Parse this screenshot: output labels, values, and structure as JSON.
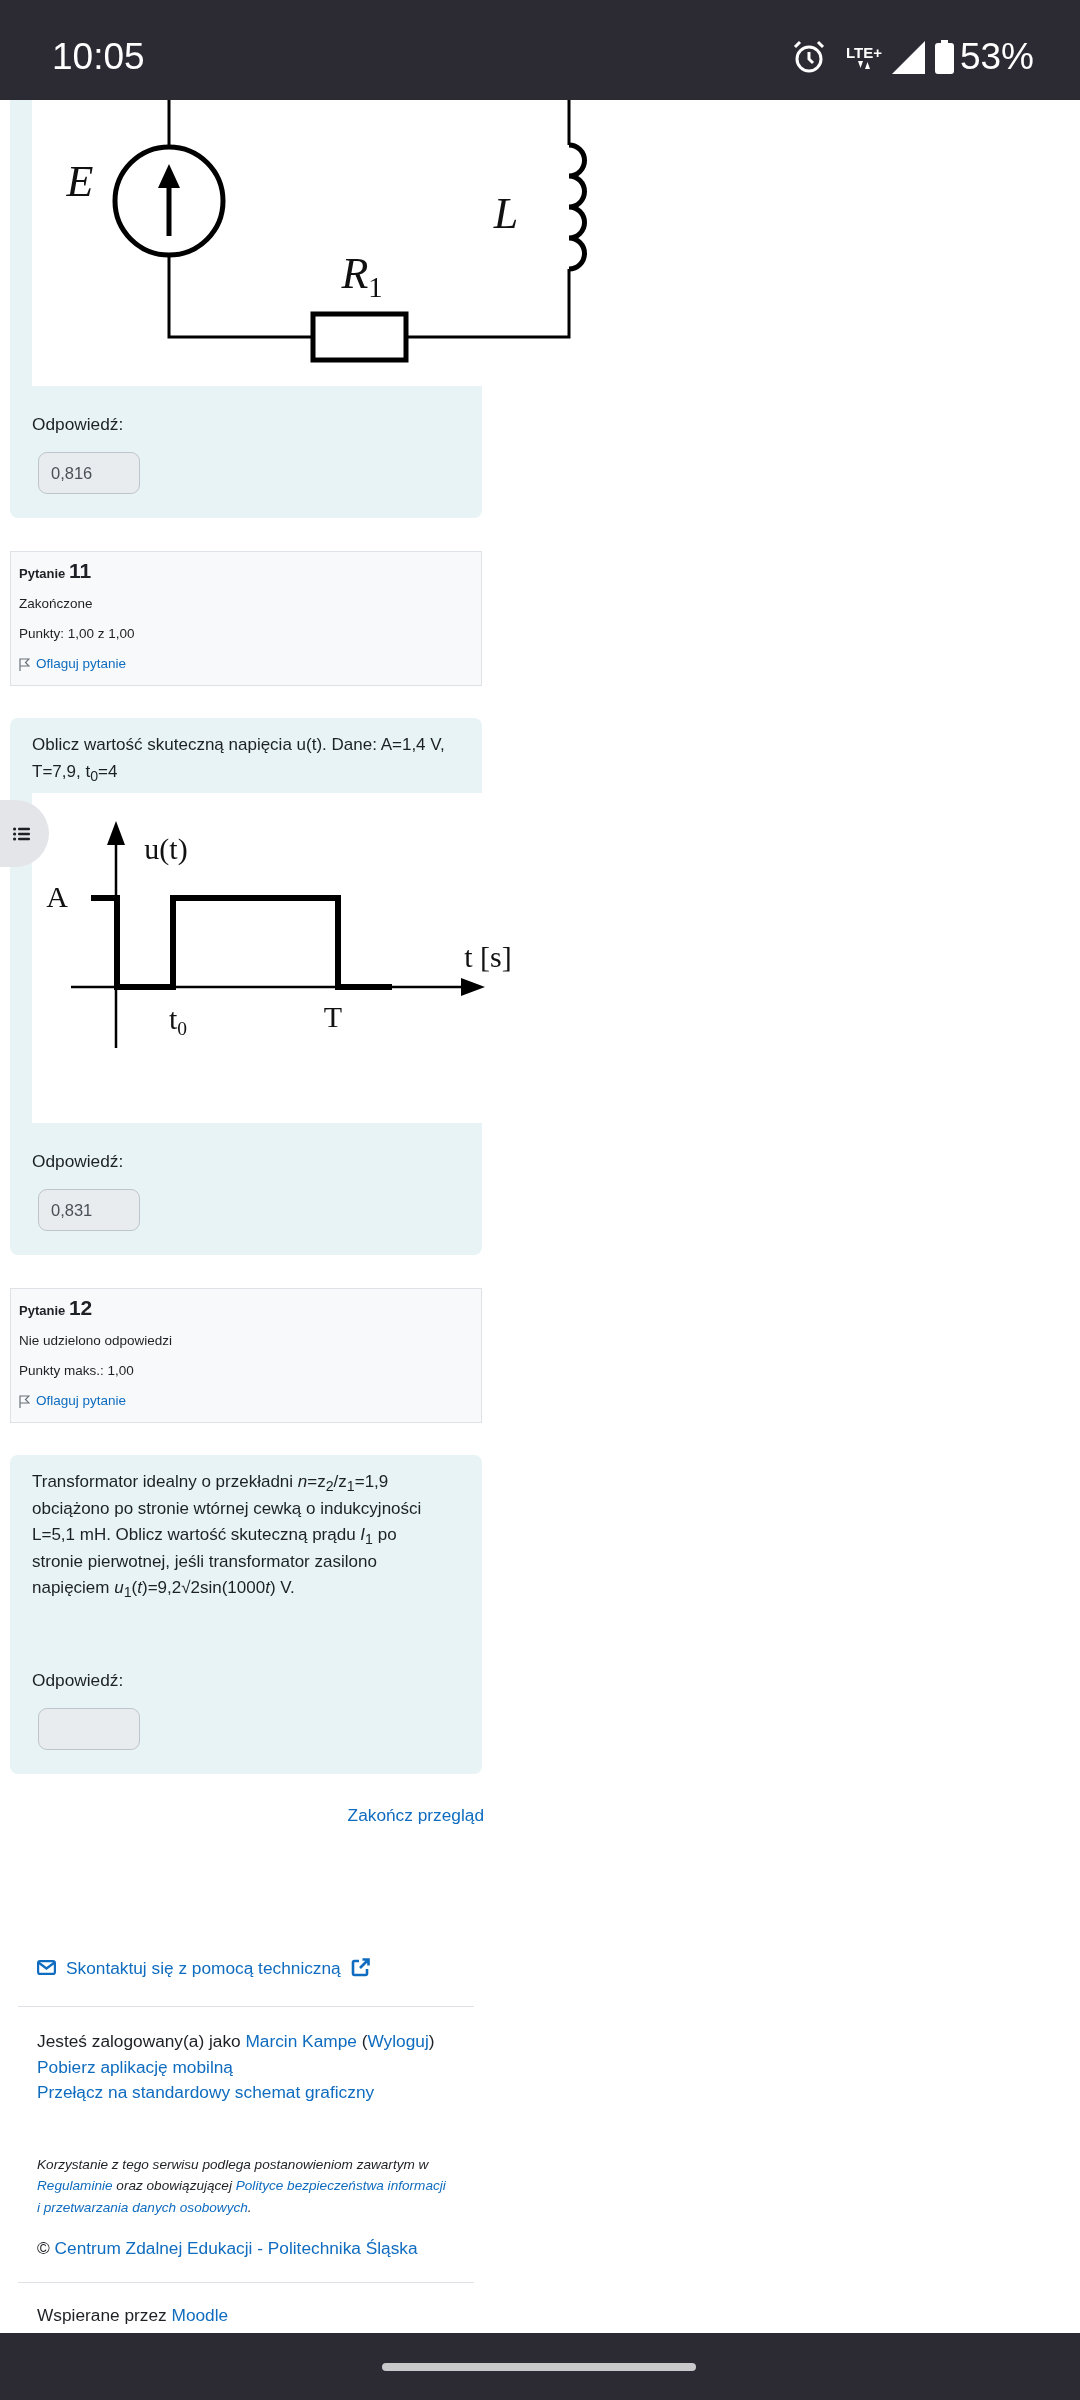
{
  "status_bar": {
    "time": "10:05",
    "network": "LTE+",
    "battery": "53%"
  },
  "questions": [
    {
      "figure": {
        "kind": "circuit",
        "labels": [
          {
            "text": "E"
          },
          {
            "text": "L"
          },
          {
            "text": "R",
            "sub": "1"
          }
        ]
      },
      "answer_label": "Odpowiedź:",
      "answer_value": "0,816"
    },
    {
      "info": {
        "label": "Pytanie",
        "number": "11",
        "status": "Zakończone",
        "points": "Punkty: 1,00 z 1,00",
        "flag_link": "Oflaguj pytanie"
      },
      "text": "Oblicz wartość skuteczną napięcia u(t). Dane: A=1,4 V, T=7,9, t$_{0}$=4",
      "figure": {
        "kind": "waveform",
        "labels": [
          {
            "text": "u(t)"
          },
          {
            "text": "A"
          },
          {
            "text": "t [s]"
          },
          {
            "text": "t",
            "sub": "0"
          },
          {
            "text": "T"
          }
        ]
      },
      "answer_label": "Odpowiedź:",
      "answer_value": "0,831"
    },
    {
      "info": {
        "label": "Pytanie",
        "number": "12",
        "status": "Nie udzielono odpowiedzi",
        "points": "Punkty maks.: 1,00",
        "flag_link": "Oflaguj pytanie"
      },
      "text_parts": [
        {
          "kind": "rich",
          "text": "Transformator idealny o przekładni *n*=z$_{2}$/z$_{1}$=1,9 obciążono po stronie wtórnej cewką o indukcyjności L=5,1 mH. Oblicz wartość skuteczną prądu *I*$_{1}$  po stronie pierwotnej, jeśli  transformator zasilono napięciem *u*$_{1}$(*t*)=9,2√2sin(1000"
        },
        {
          "kind": "italic",
          "text": "t"
        },
        {
          "kind": "rich",
          "text": ") V."
        }
      ],
      "answer_label": "Odpowiedź:"
    }
  ],
  "end_review_link": "Zakończ przegląd",
  "footer": {
    "support_link": "Skontaktuj się z pomocą techniczną",
    "login_line": {
      "before": "Jesteś zalogowany(a) jako",
      "user_link": "Marcin Kampe",
      "open": "(",
      "logout_link": "Wyloguj",
      "close": ")"
    },
    "app_link": "Pobierz aplikację mobilną",
    "theme_link": "Przełącz na standardowy schemat graficzny",
    "policy": [
      {
        "kind": "text",
        "text": "Korzystanie z tego serwisu podlega postanowieniom zawartym w "
      },
      {
        "kind": "link",
        "text": "Regulaminie"
      },
      {
        "kind": "text",
        "text": " oraz obowiązującej "
      },
      {
        "kind": "link",
        "text": "Polityce bezpieczeństwa informacji"
      },
      {
        "kind": "link",
        "text": "i przetwarzania danych osobowych"
      },
      {
        "kind": "text",
        "text": "."
      }
    ],
    "copyright": {
      "symbol": "©",
      "link": "Centrum Zdalnej Edukacji - Politechnika Śląska"
    },
    "powered": {
      "text": "Wspierane przez",
      "link": "Moodle"
    }
  }
}
